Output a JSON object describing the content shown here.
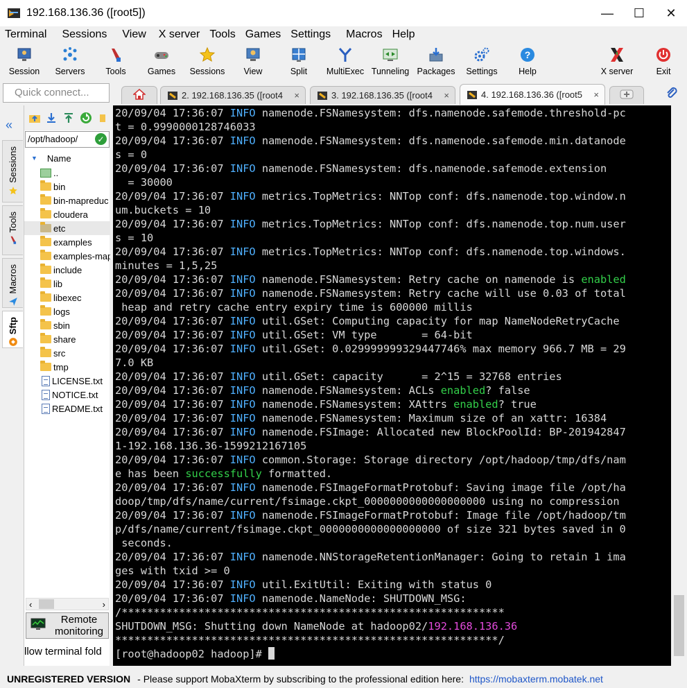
{
  "window": {
    "title": "192.168.136.36 ([root5])",
    "controls": [
      "—",
      "☐",
      "✕"
    ]
  },
  "menu": [
    "Terminal",
    "Sessions",
    "View",
    "X server",
    "Tools",
    "Games",
    "Settings",
    "Macros",
    "Help"
  ],
  "toolbar": [
    {
      "label": "Session",
      "icon": "session-icon"
    },
    {
      "label": "Servers",
      "icon": "servers-icon"
    },
    {
      "label": "Tools",
      "icon": "tools-icon"
    },
    {
      "label": "Games",
      "icon": "games-icon"
    },
    {
      "label": "Sessions",
      "icon": "star-icon"
    },
    {
      "label": "View",
      "icon": "view-icon"
    },
    {
      "label": "Split",
      "icon": "split-icon"
    },
    {
      "label": "MultiExec",
      "icon": "multiexec-icon"
    },
    {
      "label": "Tunneling",
      "icon": "tunneling-icon"
    },
    {
      "label": "Packages",
      "icon": "packages-icon"
    },
    {
      "label": "Settings",
      "icon": "settings-icon"
    },
    {
      "label": "Help",
      "icon": "help-icon"
    },
    {
      "label": "X server",
      "icon": "xserver-icon"
    },
    {
      "label": "Exit",
      "icon": "exit-icon"
    }
  ],
  "quick_connect": {
    "placeholder": "Quick connect..."
  },
  "tabs": [
    {
      "label": "2. 192.168.136.35 ([root4",
      "close": "×",
      "active": false
    },
    {
      "label": "3. 192.168.136.35 ([root4",
      "close": "×",
      "active": false
    },
    {
      "label": "4. 192.168.136.36 ([root5",
      "close": "×",
      "active": true
    }
  ],
  "side_tabs": [
    "Sessions",
    "Tools",
    "Macros",
    "Sftp"
  ],
  "sftp": {
    "path": "/opt/hadoop/",
    "column": "Name",
    "files": [
      {
        "name": "..",
        "type": "up"
      },
      {
        "name": "bin",
        "type": "folder"
      },
      {
        "name": "bin-mapreduc",
        "type": "folder"
      },
      {
        "name": "cloudera",
        "type": "folder"
      },
      {
        "name": "etc",
        "type": "folder",
        "selected": true
      },
      {
        "name": "examples",
        "type": "folder"
      },
      {
        "name": "examples-map",
        "type": "folder"
      },
      {
        "name": "include",
        "type": "folder"
      },
      {
        "name": "lib",
        "type": "folder"
      },
      {
        "name": "libexec",
        "type": "folder"
      },
      {
        "name": "logs",
        "type": "folder"
      },
      {
        "name": "sbin",
        "type": "folder"
      },
      {
        "name": "share",
        "type": "folder"
      },
      {
        "name": "src",
        "type": "folder"
      },
      {
        "name": "tmp",
        "type": "folder"
      },
      {
        "name": "LICENSE.txt",
        "type": "file"
      },
      {
        "name": "NOTICE.txt",
        "type": "file"
      },
      {
        "name": "README.txt",
        "type": "file"
      }
    ],
    "remote_monitoring": "Remote monitoring",
    "follow": "llow terminal fold"
  },
  "terminal": {
    "lines": [
      [
        [
          "t",
          "20/09/04 17:36:07 "
        ],
        [
          "i",
          "INFO"
        ],
        [
          "t",
          " namenode.FSNamesystem: dfs.namenode.safemode.threshold-pc"
        ]
      ],
      [
        [
          "t",
          "t = 0.9990000128746033"
        ]
      ],
      [
        [
          "t",
          "20/09/04 17:36:07 "
        ],
        [
          "i",
          "INFO"
        ],
        [
          "t",
          " namenode.FSNamesystem: dfs.namenode.safemode.min.datanode"
        ]
      ],
      [
        [
          "t",
          "s = 0"
        ]
      ],
      [
        [
          "t",
          "20/09/04 17:36:07 "
        ],
        [
          "i",
          "INFO"
        ],
        [
          "t",
          " namenode.FSNamesystem: dfs.namenode.safemode.extension"
        ]
      ],
      [
        [
          "t",
          "  = 30000"
        ]
      ],
      [
        [
          "t",
          "20/09/04 17:36:07 "
        ],
        [
          "i",
          "INFO"
        ],
        [
          "t",
          " metrics.TopMetrics: NNTop conf: dfs.namenode.top.window.n"
        ]
      ],
      [
        [
          "t",
          "um.buckets = 10"
        ]
      ],
      [
        [
          "t",
          "20/09/04 17:36:07 "
        ],
        [
          "i",
          "INFO"
        ],
        [
          "t",
          " metrics.TopMetrics: NNTop conf: dfs.namenode.top.num.user"
        ]
      ],
      [
        [
          "t",
          "s = 10"
        ]
      ],
      [
        [
          "t",
          "20/09/04 17:36:07 "
        ],
        [
          "i",
          "INFO"
        ],
        [
          "t",
          " metrics.TopMetrics: NNTop conf: dfs.namenode.top.windows."
        ]
      ],
      [
        [
          "t",
          "minutes = 1,5,25"
        ]
      ],
      [
        [
          "t",
          "20/09/04 17:36:07 "
        ],
        [
          "i",
          "INFO"
        ],
        [
          "t",
          " namenode.FSNamesystem: Retry cache on namenode is "
        ],
        [
          "g",
          "enabled"
        ]
      ],
      [
        [
          "t",
          "20/09/04 17:36:07 "
        ],
        [
          "i",
          "INFO"
        ],
        [
          "t",
          " namenode.FSNamesystem: Retry cache will use 0.03 of total"
        ]
      ],
      [
        [
          "t",
          " heap and retry cache entry expiry time is 600000 millis"
        ]
      ],
      [
        [
          "t",
          "20/09/04 17:36:07 "
        ],
        [
          "i",
          "INFO"
        ],
        [
          "t",
          " util.GSet: Computing capacity for map NameNodeRetryCache"
        ]
      ],
      [
        [
          "t",
          "20/09/04 17:36:07 "
        ],
        [
          "i",
          "INFO"
        ],
        [
          "t",
          " util.GSet: VM type       = 64-bit"
        ]
      ],
      [
        [
          "t",
          "20/09/04 17:36:07 "
        ],
        [
          "i",
          "INFO"
        ],
        [
          "t",
          " util.GSet: 0.029999999329447746% max memory 966.7 MB = 29"
        ]
      ],
      [
        [
          "t",
          "7.0 KB"
        ]
      ],
      [
        [
          "t",
          "20/09/04 17:36:07 "
        ],
        [
          "i",
          "INFO"
        ],
        [
          "t",
          " util.GSet: capacity      = 2^15 = 32768 entries"
        ]
      ],
      [
        [
          "t",
          "20/09/04 17:36:07 "
        ],
        [
          "i",
          "INFO"
        ],
        [
          "t",
          " namenode.FSNamesystem: ACLs "
        ],
        [
          "g",
          "enabled"
        ],
        [
          "t",
          "? false"
        ]
      ],
      [
        [
          "t",
          "20/09/04 17:36:07 "
        ],
        [
          "i",
          "INFO"
        ],
        [
          "t",
          " namenode.FSNamesystem: XAttrs "
        ],
        [
          "g",
          "enabled"
        ],
        [
          "t",
          "? true"
        ]
      ],
      [
        [
          "t",
          "20/09/04 17:36:07 "
        ],
        [
          "i",
          "INFO"
        ],
        [
          "t",
          " namenode.FSNamesystem: Maximum size of an xattr: 16384"
        ]
      ],
      [
        [
          "t",
          "20/09/04 17:36:07 "
        ],
        [
          "i",
          "INFO"
        ],
        [
          "t",
          " namenode.FSImage: Allocated new BlockPoolId: BP-201942847"
        ]
      ],
      [
        [
          "t",
          "1-192.168.136.36-1599212167105"
        ]
      ],
      [
        [
          "t",
          "20/09/04 17:36:07 "
        ],
        [
          "i",
          "INFO"
        ],
        [
          "t",
          " common.Storage: Storage directory /opt/hadoop/tmp/dfs/nam"
        ]
      ],
      [
        [
          "t",
          "e has been "
        ],
        [
          "g",
          "successfully"
        ],
        [
          "t",
          " formatted."
        ]
      ],
      [
        [
          "t",
          "20/09/04 17:36:07 "
        ],
        [
          "i",
          "INFO"
        ],
        [
          "t",
          " namenode.FSImageFormatProtobuf: Saving image file /opt/ha"
        ]
      ],
      [
        [
          "t",
          "doop/tmp/dfs/name/current/fsimage.ckpt_0000000000000000000 using no compression"
        ]
      ],
      [
        [
          "t",
          "20/09/04 17:36:07 "
        ],
        [
          "i",
          "INFO"
        ],
        [
          "t",
          " namenode.FSImageFormatProtobuf: Image file /opt/hadoop/tm"
        ]
      ],
      [
        [
          "t",
          "p/dfs/name/current/fsimage.ckpt_0000000000000000000 of size 321 bytes saved in 0"
        ]
      ],
      [
        [
          "t",
          " seconds."
        ]
      ],
      [
        [
          "t",
          "20/09/04 17:36:07 "
        ],
        [
          "i",
          "INFO"
        ],
        [
          "t",
          " namenode.NNStorageRetentionManager: Going to retain 1 ima"
        ]
      ],
      [
        [
          "t",
          "ges with txid >= 0"
        ]
      ],
      [
        [
          "t",
          "20/09/04 17:36:07 "
        ],
        [
          "i",
          "INFO"
        ],
        [
          "t",
          " util.ExitUtil: Exiting with status 0"
        ]
      ],
      [
        [
          "t",
          "20/09/04 17:36:07 "
        ],
        [
          "i",
          "INFO"
        ],
        [
          "t",
          " namenode.NameNode: SHUTDOWN_MSG:"
        ]
      ],
      [
        [
          "t",
          "/************************************************************"
        ]
      ],
      [
        [
          "t",
          "SHUTDOWN_MSG: Shutting down NameNode at hadoop02/"
        ],
        [
          "m",
          "192.168.136.36"
        ]
      ],
      [
        [
          "t",
          "************************************************************/"
        ]
      ],
      [
        [
          "t",
          "[root@hadoop02 hadoop]# "
        ],
        [
          "c",
          ""
        ]
      ]
    ]
  },
  "status": {
    "unregistered": "UNREGISTERED VERSION",
    "message": "-  Please support MobaXterm by subscribing to the professional edition here:",
    "link": "https://mobaxterm.mobatek.net"
  },
  "colors": {
    "info": "#4fb0ff",
    "enabled": "#33d04a",
    "ip": "#e34bdc",
    "link": "#1e56c8"
  }
}
